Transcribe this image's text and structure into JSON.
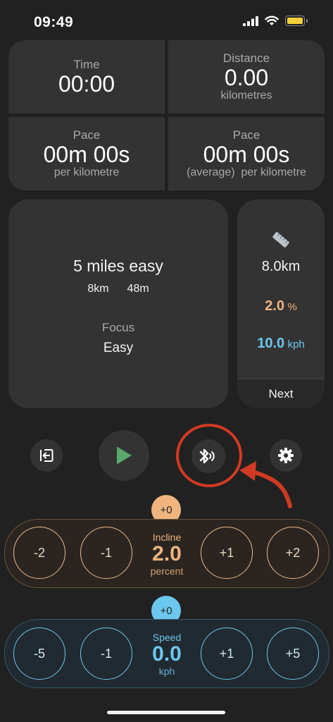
{
  "status": {
    "time": "09:49"
  },
  "stats": {
    "time": {
      "label": "Time",
      "value": "00:00"
    },
    "distance": {
      "label": "Distance",
      "value": "0.00",
      "unit": "kilometres"
    },
    "pace": {
      "label": "Pace",
      "value": "00m 00s",
      "unit": "per kilometre"
    },
    "pace_avg": {
      "label": "Pace",
      "value": "00m 00s",
      "unit": "(average)  per kilometre"
    }
  },
  "workout": {
    "title": "5 miles easy",
    "distance": "8km",
    "duration": "48m",
    "focus_label": "Focus",
    "focus_value": "Easy"
  },
  "segment": {
    "distance": "8.0km",
    "incline": "2.0",
    "incline_unit": "%",
    "speed": "10.0",
    "speed_unit": "kph",
    "next_label": "Next"
  },
  "controls": [
    "exit",
    "play",
    "sound-bluetooth",
    "settings"
  ],
  "incline": {
    "offset": "+0",
    "label": "Incline",
    "value": "2.0",
    "unit": "percent",
    "buttons": [
      "-2",
      "-1",
      "+1",
      "+2"
    ]
  },
  "speed": {
    "offset": "+0",
    "label": "Speed",
    "value": "0.0",
    "unit": "kph",
    "buttons": [
      "-5",
      "-1",
      "+1",
      "+5"
    ]
  },
  "colors": {
    "incline": "#f0b57f",
    "speed": "#6cc7ee",
    "play": "#5aa86a",
    "annotation": "#d03a22"
  }
}
